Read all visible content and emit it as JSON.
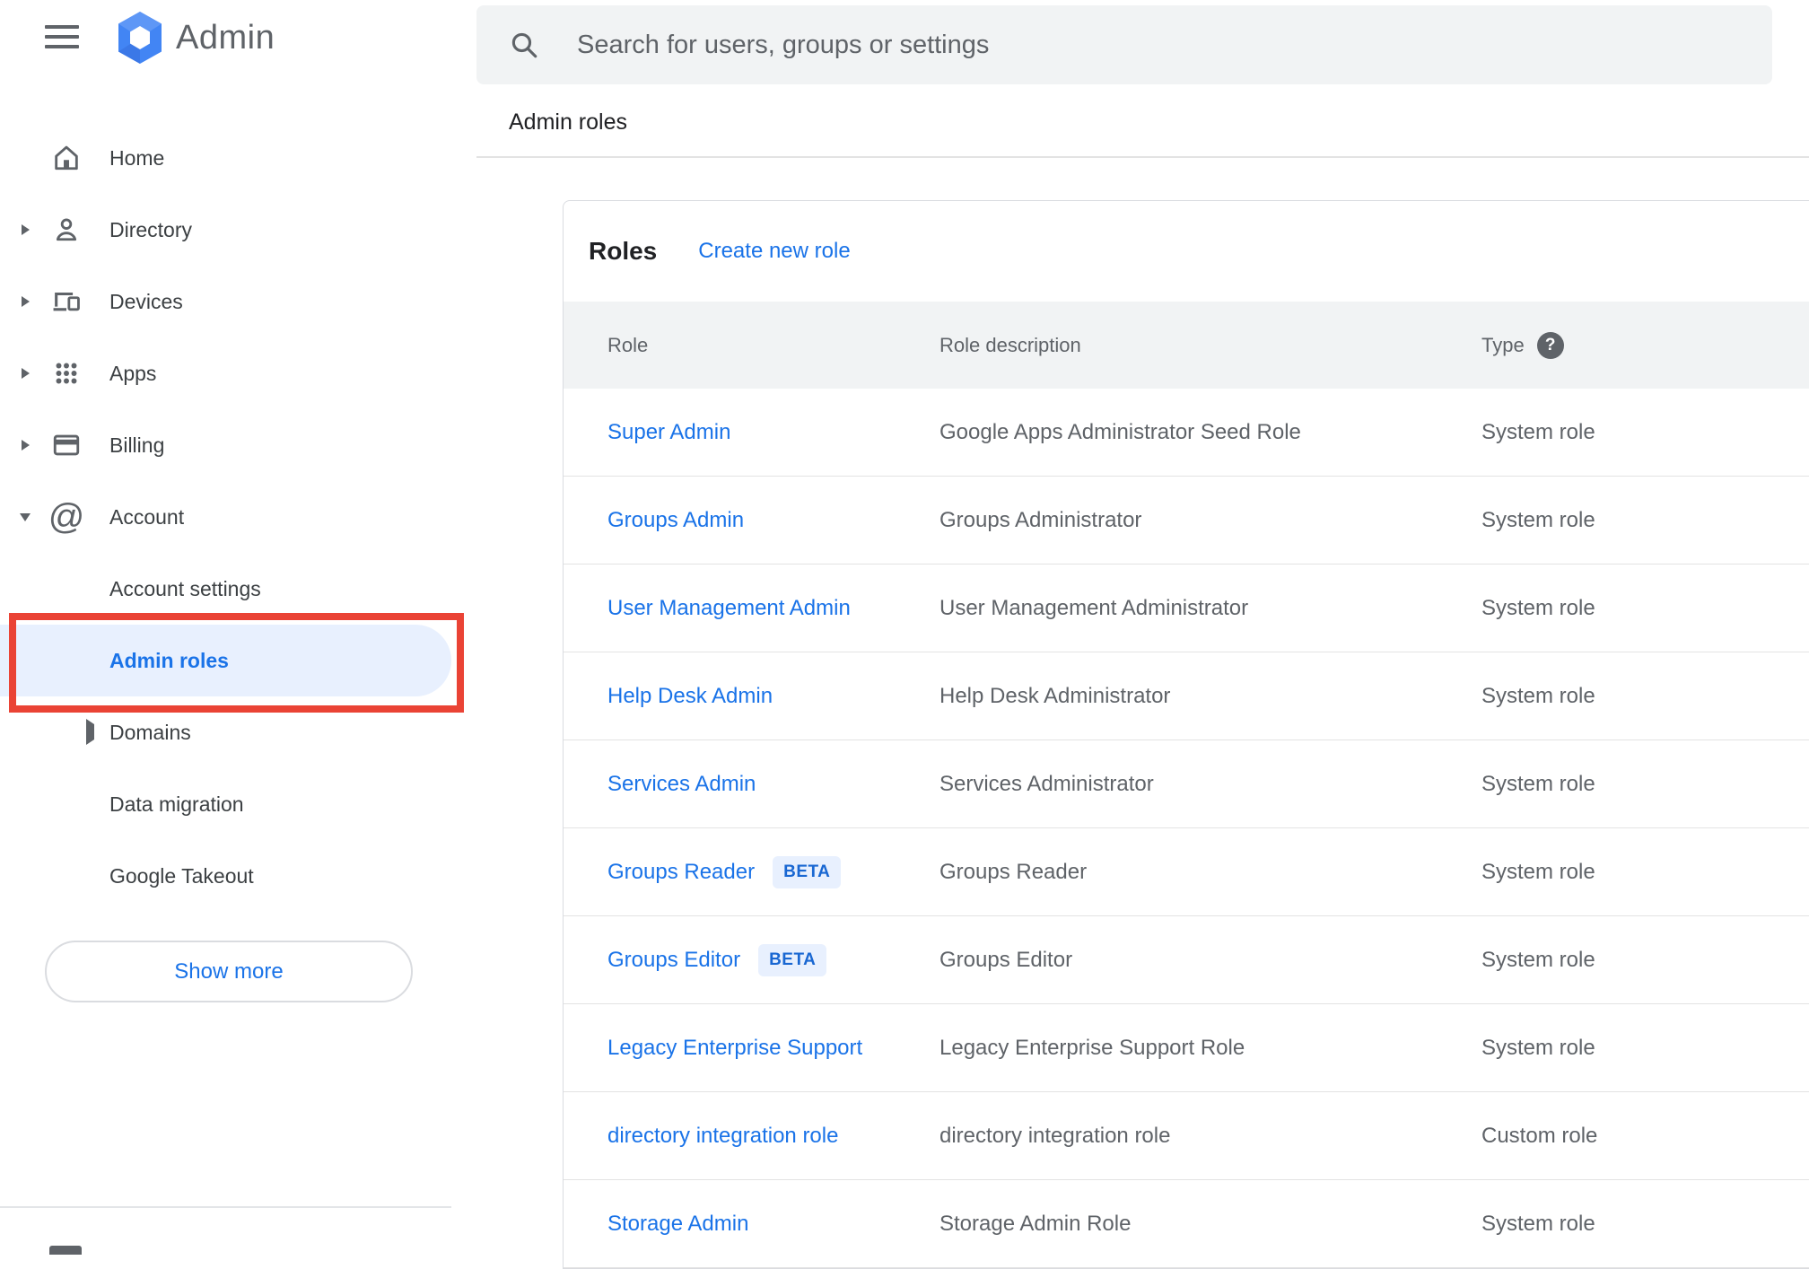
{
  "header": {
    "product_name": "Admin",
    "search_placeholder": "Search for users, groups or settings"
  },
  "breadcrumb": "Admin roles",
  "sidebar": {
    "items": [
      {
        "label": "Home"
      },
      {
        "label": "Directory"
      },
      {
        "label": "Devices"
      },
      {
        "label": "Apps"
      },
      {
        "label": "Billing"
      },
      {
        "label": "Account"
      }
    ],
    "sub_items": [
      {
        "label": "Account settings"
      },
      {
        "label": "Admin roles"
      },
      {
        "label": "Domains"
      },
      {
        "label": "Data migration"
      },
      {
        "label": "Google Takeout"
      }
    ],
    "active_item": "Admin roles",
    "show_more_label": "Show more"
  },
  "roles": {
    "title": "Roles",
    "create_link": "Create new role",
    "columns": [
      "Role",
      "Role description",
      "Type"
    ],
    "rows": [
      {
        "name": "Super Admin",
        "badge": "",
        "description": "Google Apps Administrator Seed Role",
        "type": "System role"
      },
      {
        "name": "Groups Admin",
        "badge": "",
        "description": "Groups Administrator",
        "type": "System role"
      },
      {
        "name": "User Management Admin",
        "badge": "",
        "description": "User Management Administrator",
        "type": "System role"
      },
      {
        "name": "Help Desk Admin",
        "badge": "",
        "description": "Help Desk Administrator",
        "type": "System role"
      },
      {
        "name": "Services Admin",
        "badge": "",
        "description": "Services Administrator",
        "type": "System role"
      },
      {
        "name": "Groups Reader",
        "badge": "BETA",
        "description": "Groups Reader",
        "type": "System role"
      },
      {
        "name": "Groups Editor",
        "badge": "BETA",
        "description": "Groups Editor",
        "type": "System role"
      },
      {
        "name": "Legacy Enterprise Support",
        "badge": "",
        "description": "Legacy Enterprise Support Role",
        "type": "System role"
      },
      {
        "name": "directory integration role",
        "badge": "",
        "description": "directory integration role",
        "type": "Custom role"
      },
      {
        "name": "Storage Admin",
        "badge": "",
        "description": "Storage Admin Role",
        "type": "System role"
      }
    ]
  },
  "colors": {
    "accent_blue": "#1a73e8",
    "active_pill_bg": "#e8f0fe",
    "annotation_red": "#ea4335",
    "header_band_bg": "#f1f3f4",
    "text_gray": "#5f6368"
  }
}
